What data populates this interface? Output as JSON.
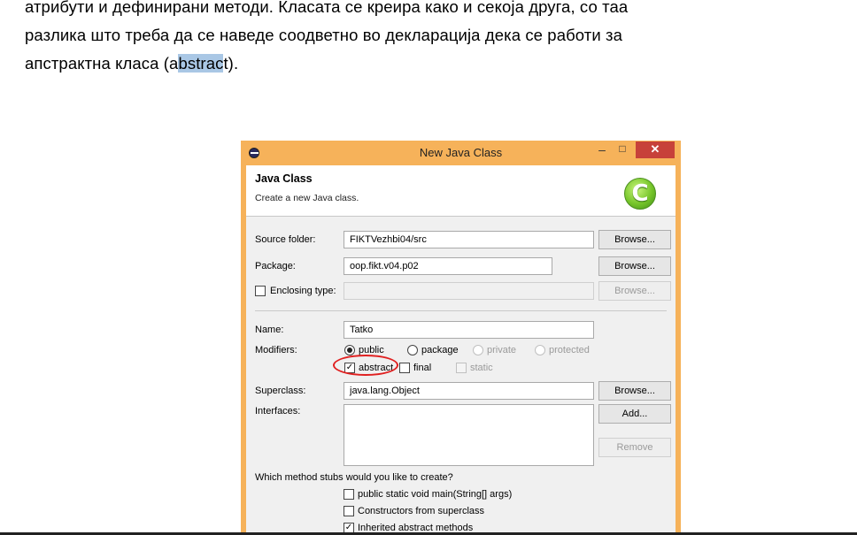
{
  "document": {
    "line1": "атрибути и дефинирани методи. Класата се креира како и секоја друга, со таа",
    "line2": "разлика што треба да се наведе соодветно во декларација дека се работи за",
    "line3_before": "апстрактна класа (a",
    "line3_highlight": "bstrac",
    "line3_after": "t)."
  },
  "dialog": {
    "title": "New Java Class",
    "minimize": "–",
    "maximize": "□",
    "close": "✕",
    "banner_title": "Java Class",
    "banner_subtitle": "Create a new Java class.",
    "class_icon_letter": "C",
    "source_folder_label": "Source folder:",
    "source_folder_value": "FIKTVezhbi04/src",
    "package_label": "Package:",
    "package_value": "oop.fikt.v04.p02",
    "enclosing_type_label": "Enclosing type:",
    "browse": "Browse...",
    "name_label": "Name:",
    "name_value": "Tatko",
    "modifiers_label": "Modifiers:",
    "mod_public": "public",
    "mod_package": "package",
    "mod_private": "private",
    "mod_protected": "protected",
    "mod_abstract": "abstract",
    "mod_final": "final",
    "mod_static": "static",
    "superclass_label": "Superclass:",
    "superclass_value": "java.lang.Object",
    "interfaces_label": "Interfaces:",
    "add": "Add...",
    "remove": "Remove",
    "stubs_question": "Which method stubs would you like to create?",
    "stub_main": "public static void main(String[] args)",
    "stub_constructors": "Constructors from superclass",
    "stub_inherited": "Inherited abstract methods",
    "check_mark": "✓"
  }
}
